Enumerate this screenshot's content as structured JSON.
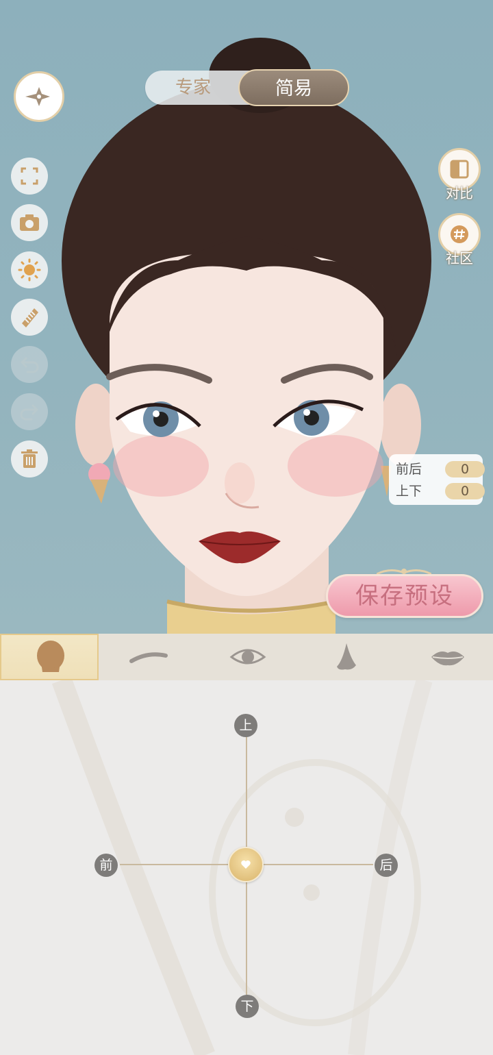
{
  "mode_toggle": {
    "expert_label": "专家",
    "simple_label": "简易",
    "selected": "简易"
  },
  "left_toolbar": [
    {
      "name": "fullscreen-icon",
      "enabled": true
    },
    {
      "name": "camera-icon",
      "enabled": true
    },
    {
      "name": "light-icon",
      "enabled": true
    },
    {
      "name": "comb-icon",
      "enabled": true
    },
    {
      "name": "undo-icon",
      "enabled": false
    },
    {
      "name": "redo-icon",
      "enabled": false
    },
    {
      "name": "trash-icon",
      "enabled": true
    }
  ],
  "right_buttons": {
    "compare_label": "对比",
    "community_label": "社区"
  },
  "values": {
    "front_back_label": "前后",
    "front_back_value": "0",
    "up_down_label": "上下",
    "up_down_value": "0"
  },
  "save_preset_label": "保存预设",
  "category_tabs": [
    {
      "name": "face-shape-icon",
      "active": true
    },
    {
      "name": "eyebrow-icon",
      "active": false
    },
    {
      "name": "eye-icon",
      "active": false
    },
    {
      "name": "nose-icon",
      "active": false
    },
    {
      "name": "lips-icon",
      "active": false
    }
  ],
  "joystick": {
    "up_label": "上",
    "down_label": "下",
    "front_label": "前",
    "back_label": "后",
    "front_back_value": 0,
    "up_down_value": 0
  },
  "colors": {
    "background": "#8fb0bb",
    "accent_gold": "#e3cfa8",
    "save_pink": "#ee9aab",
    "toggle_selected": "#7d6d5f"
  }
}
